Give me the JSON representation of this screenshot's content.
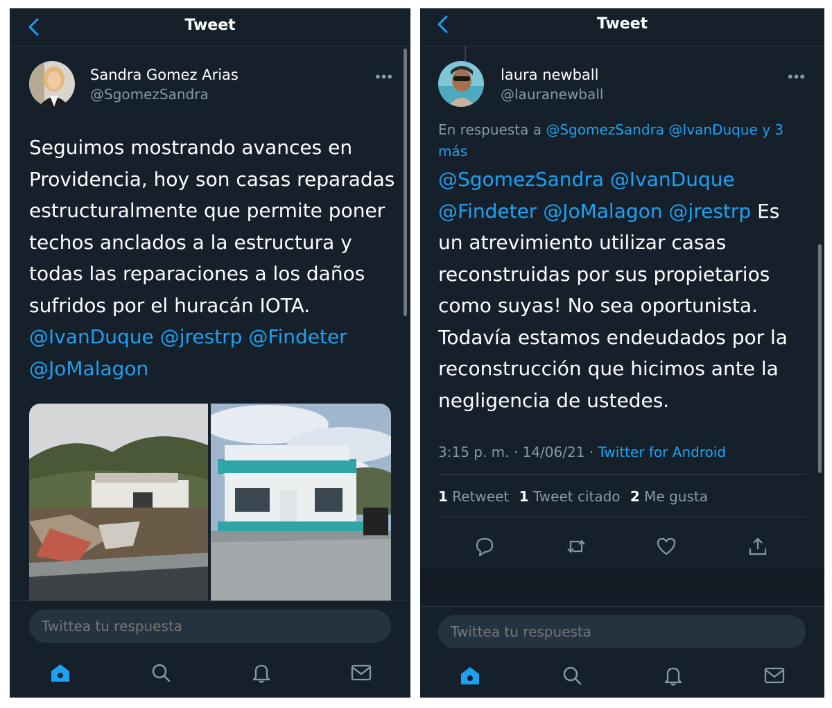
{
  "left": {
    "header_title": "Tweet",
    "author": {
      "name": "Sandra Gomez Arias",
      "handle": "@SgomezSandra"
    },
    "tweet": {
      "lines": [
        "Seguimos mostrando avances en",
        "Providencia, hoy son casas reparadas",
        "estructuralmente que permite poner",
        "techos anclados a la estructura y",
        "todas las reparaciones a los daños",
        "sufridos por el huracán IOTA."
      ],
      "mentions_line1": [
        "@IvanDuque",
        "@jrestrp",
        "@Findeter"
      ],
      "mentions_line2": [
        "@JoMalagon"
      ]
    },
    "reply_placeholder": "Twittea tu respuesta"
  },
  "right": {
    "header_title": "Tweet",
    "author": {
      "name": "laura newball",
      "handle": "@lauranewball"
    },
    "reply_context": {
      "prefix": "En respuesta a",
      "mentions": [
        "@SgomezSandra",
        "@IvanDuque"
      ],
      "suffix": "y 3 más"
    },
    "tweet": {
      "mentions_line1": [
        "@SgomezSandra",
        "@IvanDuque"
      ],
      "mentions_line2": [
        "@Findeter",
        "@JoMalagon",
        "@jrestrp"
      ],
      "line2_tail": "Es",
      "lines": [
        "un atrevimiento utilizar casas",
        "reconstruidas por sus propietarios",
        "como suyas! No sea oportunista.",
        "Todavía estamos endeudados por la",
        "reconstrucción que hicimos ante la",
        "negligencia de ustedes."
      ]
    },
    "meta": {
      "time": "3:15 p. m.",
      "date": "14/06/21",
      "source": "Twitter for Android"
    },
    "stats": {
      "retweets_count": "1",
      "retweets_label": "Retweet",
      "quotes_count": "1",
      "quotes_label": "Tweet citado",
      "likes_count": "2",
      "likes_label": "Me gusta"
    },
    "reply_placeholder": "Twittea tu respuesta"
  },
  "colors": {
    "background": "#15202b",
    "link": "#1da1f2",
    "secondary_text": "#8899a6",
    "divider": "#2f3b46"
  },
  "icons": [
    "back-arrow-icon",
    "more-options-icon",
    "home-icon",
    "search-icon",
    "notifications-bell-icon",
    "messages-envelope-icon",
    "reply-icon",
    "retweet-icon",
    "like-heart-icon",
    "share-icon"
  ]
}
